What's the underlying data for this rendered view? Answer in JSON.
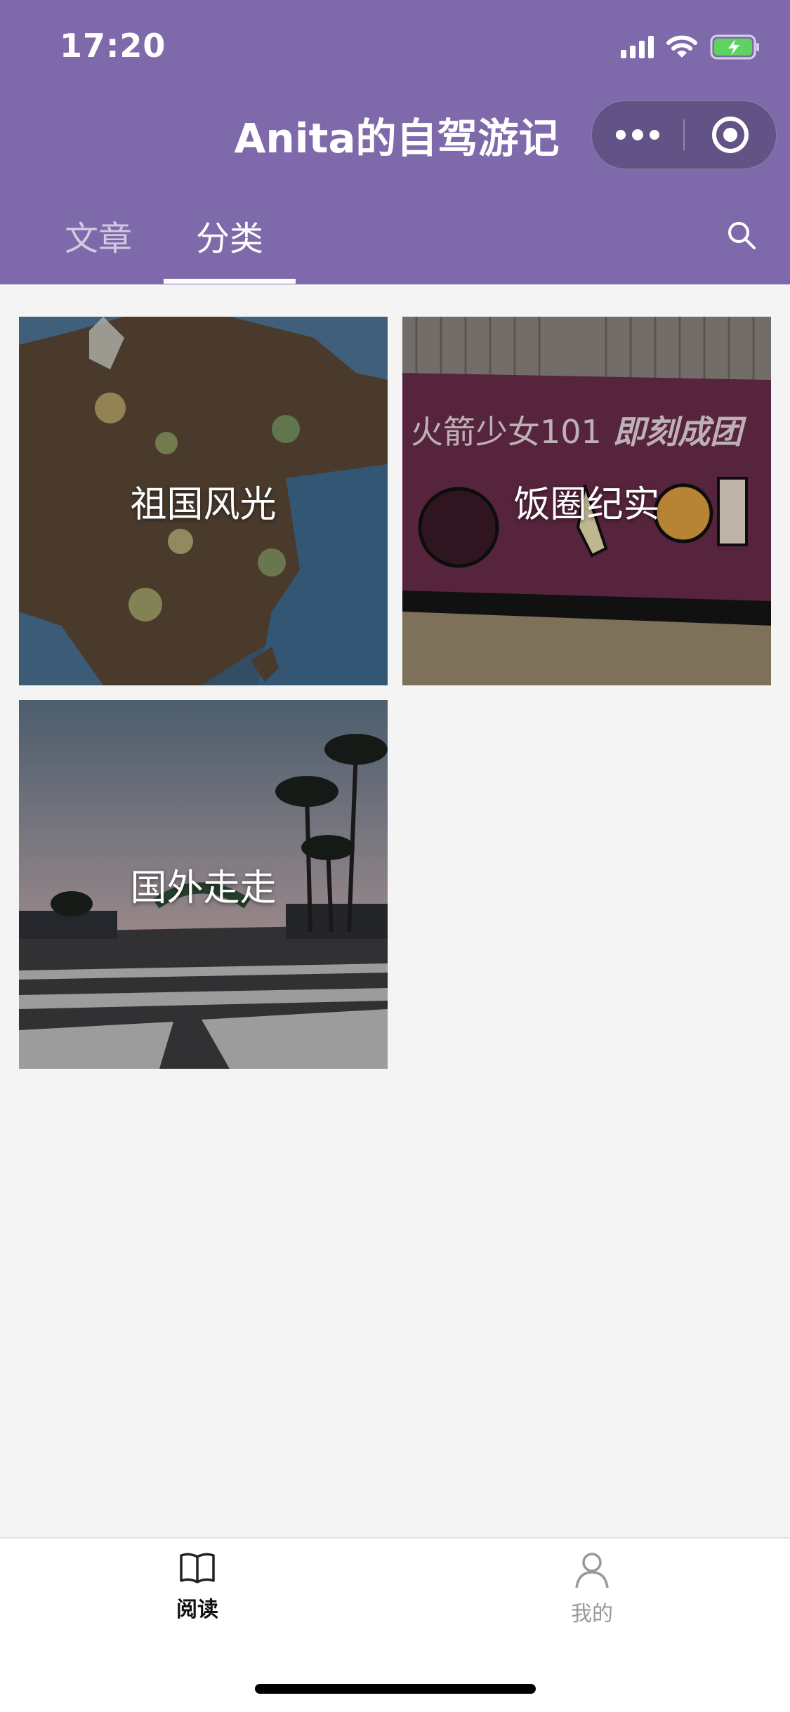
{
  "status_bar": {
    "time": "17:20"
  },
  "header": {
    "title": "Anita的自驾游记",
    "tabs": [
      {
        "label": "文章",
        "active": false
      },
      {
        "label": "分类",
        "active": true
      }
    ],
    "background_color": "#7e69ab"
  },
  "categories": [
    {
      "label": "祖国风光",
      "image": "china-map-photo"
    },
    {
      "label": "饭圈纪实",
      "image": "rocket-girls-banner-photo"
    },
    {
      "label": "国外走走",
      "image": "street-palm-trees-photo"
    }
  ],
  "banner_text": {
    "left": "火箭少女101",
    "right": "即刻成团"
  },
  "tab_bar": {
    "items": [
      {
        "label": "阅读",
        "icon": "book-icon",
        "active": true
      },
      {
        "label": "我的",
        "icon": "person-icon",
        "active": false
      }
    ]
  }
}
